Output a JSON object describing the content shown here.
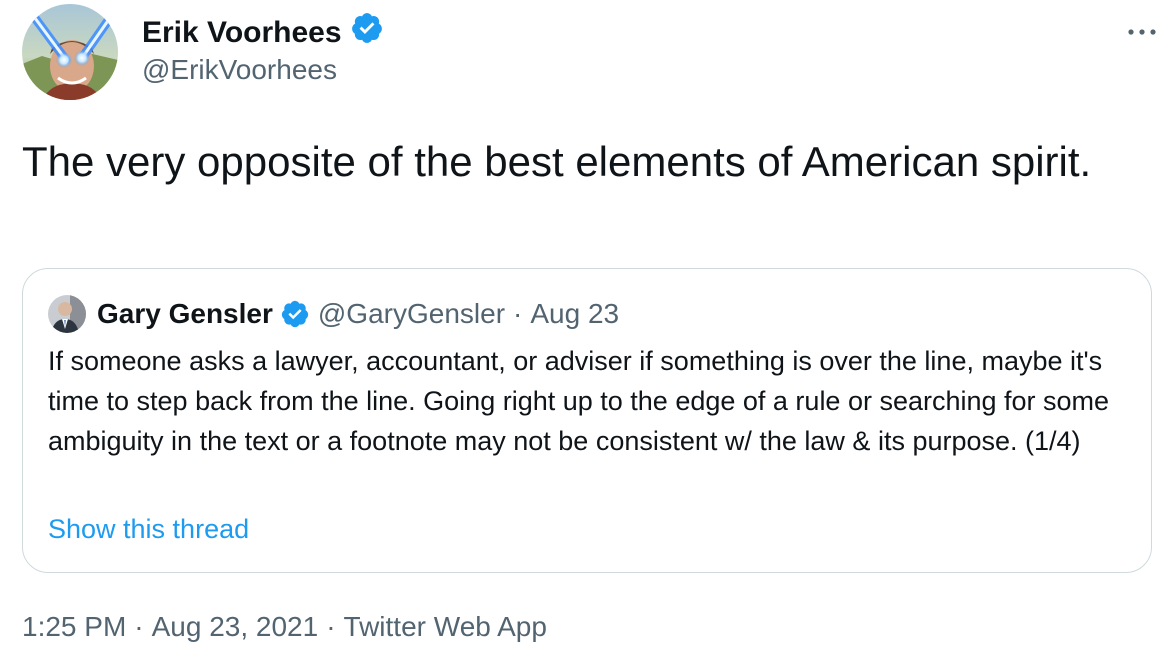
{
  "author": {
    "name": "Erik Voorhees",
    "handle": "@ErikVoorhees",
    "verified": true
  },
  "tweet": {
    "text": "The very opposite of the best elements of American spirit."
  },
  "quoted": {
    "name": "Gary Gensler",
    "handle": "@GaryGensler",
    "separator": "·",
    "date": "Aug 23",
    "verified": true,
    "text": "If someone asks a lawyer, accountant, or adviser if something is over the line, maybe it's time to step back from the line. Going right up to the edge of a rule or searching for some ambiguity in the text or a footnote may not be consistent w/ the law & its purpose. (1/4)",
    "thread_link": "Show this thread"
  },
  "meta": {
    "time": "1:25 PM",
    "separator": "·",
    "date": "Aug 23, 2021",
    "source": "Twitter Web App"
  },
  "icons": {
    "verified": "verified-badge-icon",
    "more": "more-options-icon"
  },
  "colors": {
    "text": "#0f1419",
    "secondary": "#536471",
    "link": "#1d9bf0",
    "border": "#cfd9de"
  }
}
